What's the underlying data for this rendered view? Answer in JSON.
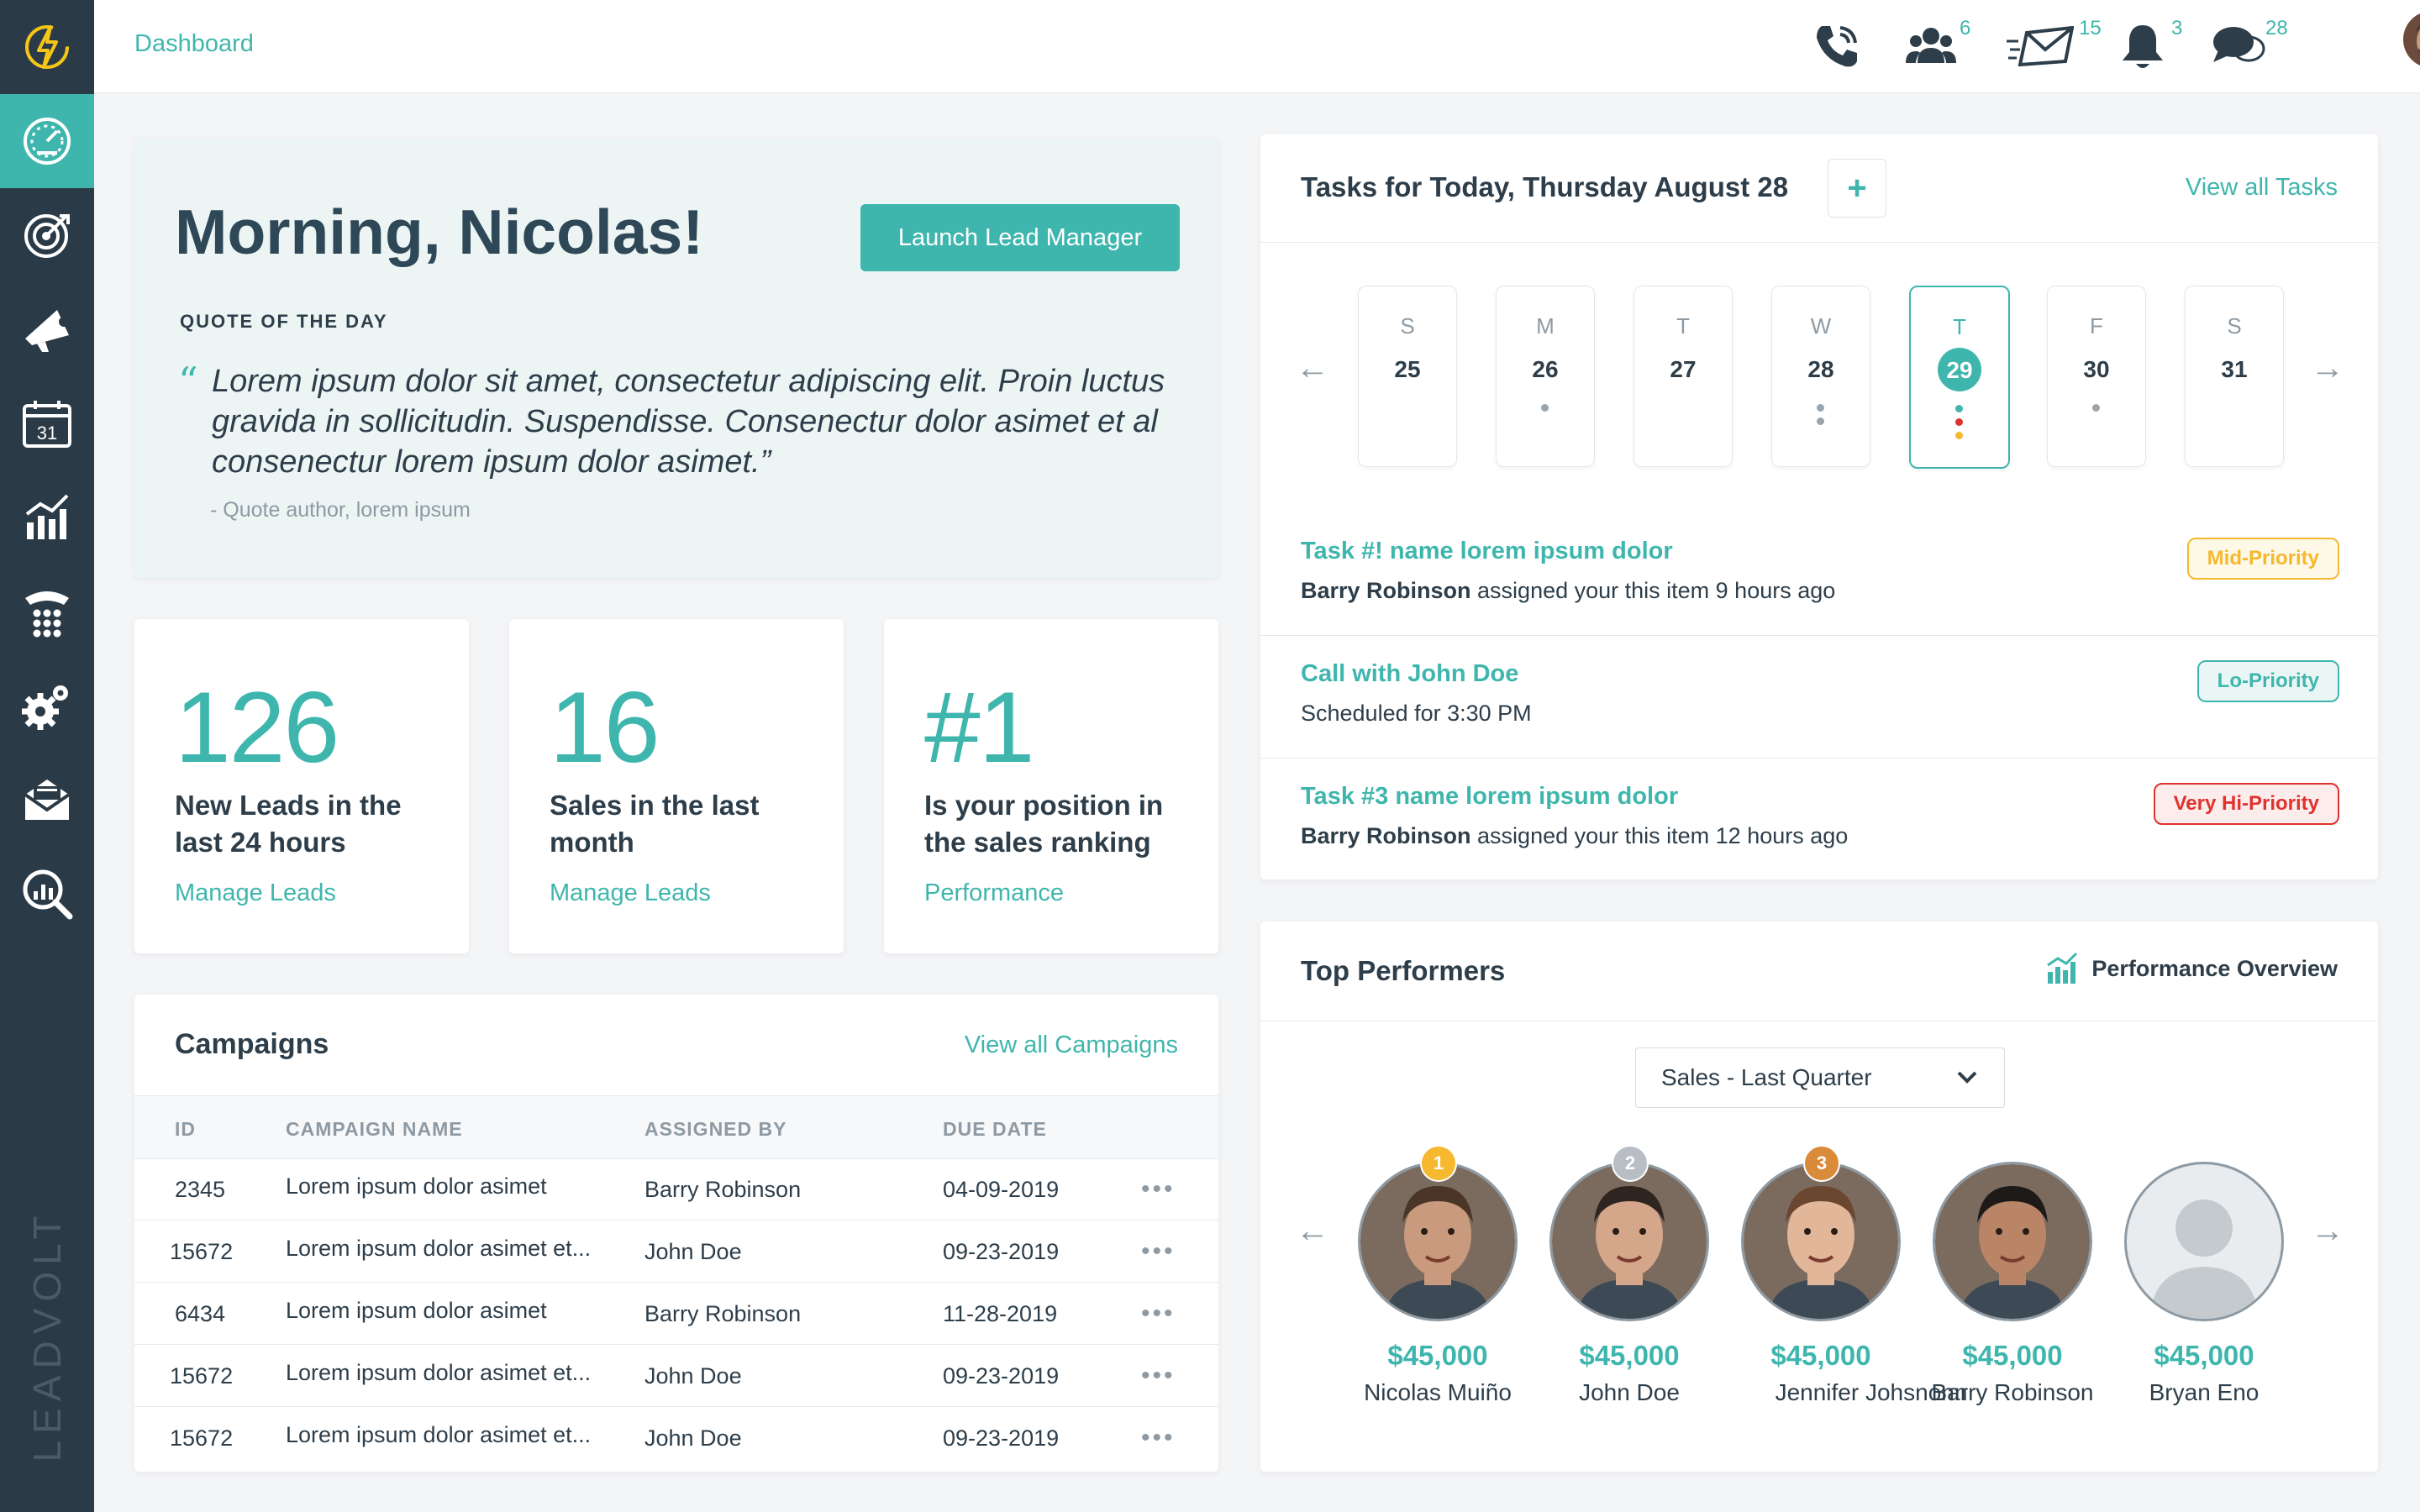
{
  "app": {
    "brand": "LEADVOLT",
    "breadcrumb": "Dashboard"
  },
  "sidebar": {
    "items": [
      {
        "icon": "lightning-logo-icon"
      },
      {
        "icon": "dashboard-gauge-icon",
        "active": true
      },
      {
        "icon": "target-icon"
      },
      {
        "icon": "megaphone-icon"
      },
      {
        "icon": "calendar-icon",
        "label": "31"
      },
      {
        "icon": "bar-chart-icon"
      },
      {
        "icon": "phone-keypad-icon"
      },
      {
        "icon": "gears-icon"
      },
      {
        "icon": "envelope-icon"
      },
      {
        "icon": "search-analytics-icon"
      }
    ]
  },
  "topbar": {
    "icons": [
      {
        "name": "phone-icon",
        "count": ""
      },
      {
        "name": "users-icon",
        "count": "6"
      },
      {
        "name": "mail-fast-icon",
        "count": "15"
      },
      {
        "name": "bell-icon",
        "count": "3"
      },
      {
        "name": "chat-icon",
        "count": "28"
      }
    ]
  },
  "greeting": {
    "title": "Morning, Nicolas!",
    "button": "Launch Lead Manager",
    "quote_label": "QUOTE OF THE DAY",
    "quote_mark": "“",
    "quote": "Lorem ipsum dolor sit amet, consectetur adipiscing elit. Proin luctus gravida in sollicitudin. Suspendisse. Consenectur dolor asimet et al consenectur lorem ipsum dolor asimet.”",
    "author": "- Quote author, lorem ipsum"
  },
  "stats": [
    {
      "value": "126",
      "desc": "New Leads in the last 24 hours",
      "link": "Manage Leads"
    },
    {
      "value": "16",
      "desc": "Sales in the last month",
      "link": "Manage Leads"
    },
    {
      "value": "#1",
      "desc": "Is your position in the sales ranking",
      "link": "Performance"
    }
  ],
  "campaigns": {
    "title": "Campaigns",
    "view_all": "View all Campaigns",
    "columns": [
      "ID",
      "CAMPAIGN NAME",
      "ASSIGNED BY",
      "DUE DATE"
    ],
    "rows": [
      {
        "id": "2345",
        "name": "Lorem ipsum dolor asimet",
        "by": "Barry Robinson",
        "due": "04-09-2019"
      },
      {
        "id": "15672",
        "name": "Lorem ipsum dolor asimet et...",
        "by": "John Doe",
        "due": "09-23-2019"
      },
      {
        "id": "6434",
        "name": "Lorem ipsum dolor asimet",
        "by": "Barry Robinson",
        "due": "11-28-2019"
      },
      {
        "id": "15672",
        "name": "Lorem ipsum dolor asimet et...",
        "by": "John Doe",
        "due": "09-23-2019"
      },
      {
        "id": "15672",
        "name": "Lorem ipsum dolor asimet et...",
        "by": "John Doe",
        "due": "09-23-2019"
      }
    ],
    "row_action": "•••"
  },
  "tasks": {
    "title": "Tasks for Today, Thursday August 28",
    "add": "+",
    "view_all": "View all Tasks",
    "days": [
      {
        "letter": "S",
        "num": "25",
        "dots": []
      },
      {
        "letter": "M",
        "num": "26",
        "dots": [
          "#9aa4ac"
        ]
      },
      {
        "letter": "T",
        "num": "27",
        "dots": []
      },
      {
        "letter": "W",
        "num": "28",
        "dots": [
          "#9aa4ac",
          "#9aa4ac"
        ]
      },
      {
        "letter": "T",
        "num": "29",
        "dots": [
          "#3fb6ad",
          "#e0322e",
          "#f5b82e"
        ],
        "selected": true
      },
      {
        "letter": "F",
        "num": "30",
        "dots": [
          "#9aa4ac"
        ]
      },
      {
        "letter": "S",
        "num": "31",
        "dots": []
      }
    ],
    "items": [
      {
        "title": "Task #! name lorem ipsum dolor",
        "who": "Barry Robinson",
        "rest": " assigned your this item 9 hours ago",
        "badge": "Mid-Priority",
        "badge_color": "#f5b82e",
        "badge_bg": "#fef8e7"
      },
      {
        "title": "Call with John Doe",
        "who": "",
        "rest": "Scheduled for 3:30 PM",
        "badge": "Lo-Priority",
        "badge_color": "#3fb6ad",
        "badge_bg": "#eaf6f5"
      },
      {
        "title": "Task #3 name lorem ipsum dolor",
        "who": "Barry Robinson",
        "rest": " assigned your this item 12 hours ago",
        "badge": "Very Hi-Priority",
        "badge_color": "#e0322e",
        "badge_bg": "#fdecec"
      }
    ]
  },
  "performers": {
    "title": "Top Performers",
    "overview": "Performance Overview",
    "select": "Sales - Last Quarter",
    "people": [
      {
        "rank": "1",
        "rank_color": "#f5b82e",
        "amount": "$45,000",
        "name": "Nicolas Muiño",
        "skin": "#c99a7d",
        "hair": "#4a3526"
      },
      {
        "rank": "2",
        "rank_color": "#b8bec4",
        "amount": "$45,000",
        "name": "John Doe",
        "skin": "#d4a68a",
        "hair": "#2f2520"
      },
      {
        "rank": "3",
        "rank_color": "#d98b3a",
        "amount": "$45,000",
        "name": "Jennifer Johsnonn",
        "skin": "#e2b699",
        "hair": "#6b4630"
      },
      {
        "rank": "",
        "rank_color": "",
        "amount": "$45,000",
        "name": "Barry Robinson",
        "skin": "#b98566",
        "hair": "#1e1a18"
      },
      {
        "rank": "",
        "rank_color": "",
        "amount": "$45,000",
        "name": "Bryan Eno",
        "skin": "",
        "hair": ""
      }
    ]
  },
  "colors": {
    "accent": "#3fb6ad",
    "sidebar": "#2b3a47",
    "logo": "#f5c518"
  }
}
